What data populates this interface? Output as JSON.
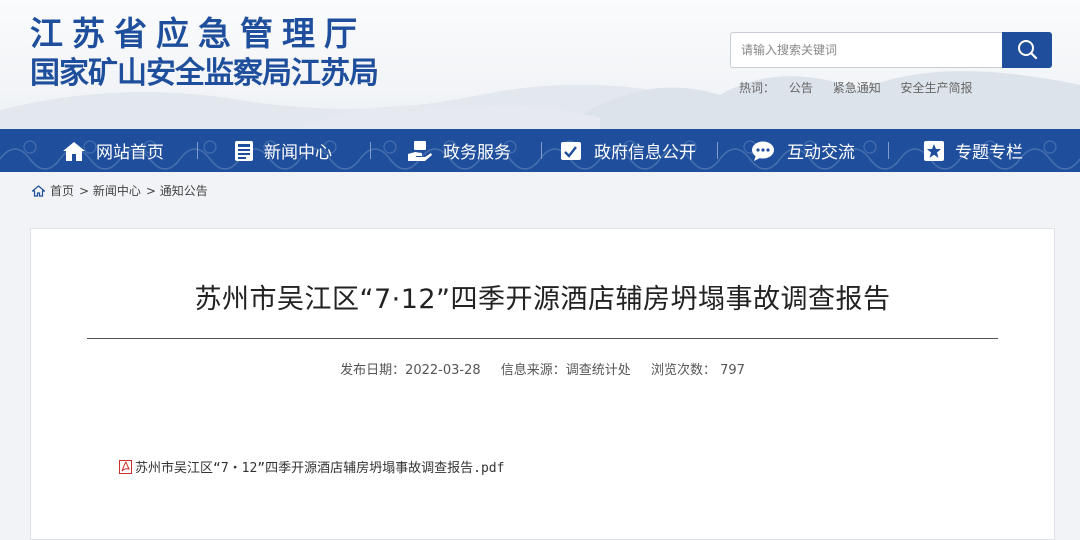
{
  "header": {
    "logo_line1": "江苏省应急管理厅",
    "logo_line2": "国家矿山安全监察局江苏局",
    "search_placeholder": "请输入搜索关键词",
    "hot_label": "热词：",
    "hot_words": [
      "公告",
      "紧急通知",
      "安全生产简报"
    ]
  },
  "nav": {
    "items": [
      {
        "label": "网站首页",
        "icon": "home-icon"
      },
      {
        "label": "新闻中心",
        "icon": "news-icon"
      },
      {
        "label": "政务服务",
        "icon": "service-icon"
      },
      {
        "label": "政府信息公开",
        "icon": "info-icon"
      },
      {
        "label": "互动交流",
        "icon": "chat-icon"
      },
      {
        "label": "专题专栏",
        "icon": "bookmark-icon"
      }
    ]
  },
  "breadcrumb": [
    "首页",
    "> 新闻中心",
    "> 通知公告"
  ],
  "article": {
    "title": "苏州市吴江区“7·12”四季开源酒店辅房坍塌事故调查报告",
    "publish_date": "发布日期：2022-03-28",
    "source": "信息来源：调查统计处",
    "views": "浏览次数： 797",
    "attachment": "苏州市吴江区“7・12”四季开源酒店辅房坍塌事故调查报告.pdf"
  },
  "colors": {
    "brand": "#1f4f9c",
    "page_bg": "#f1f3f6"
  }
}
